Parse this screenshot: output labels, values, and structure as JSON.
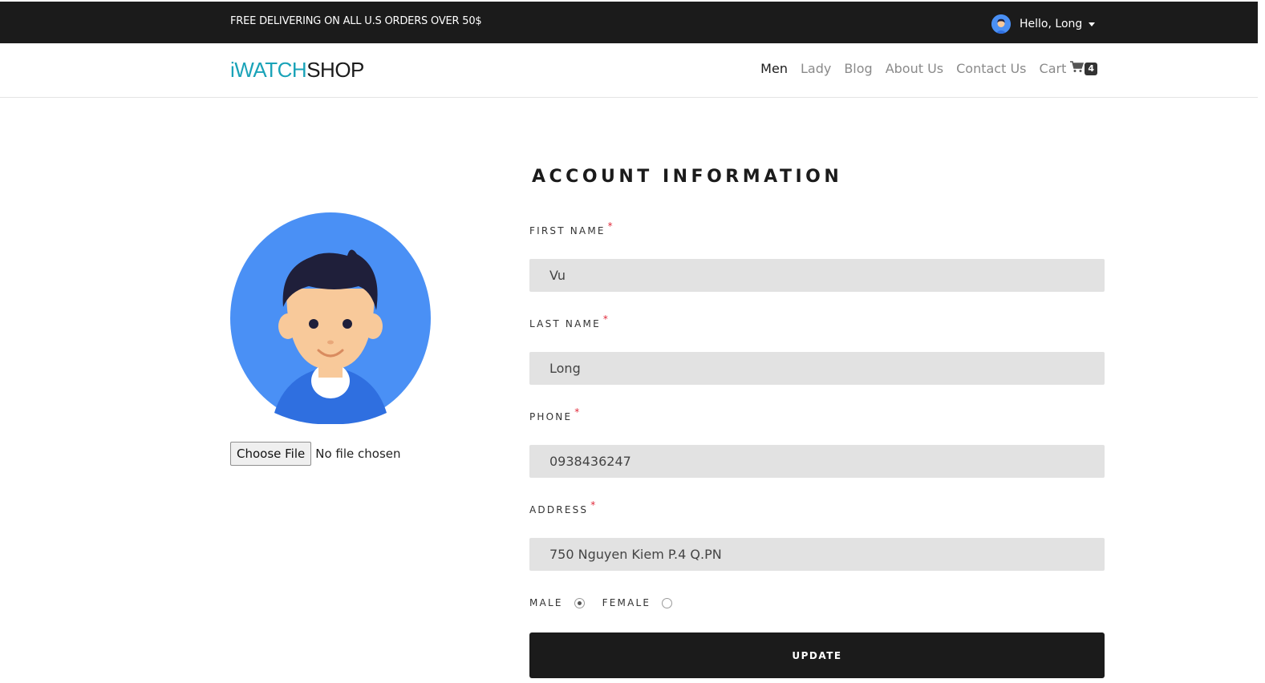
{
  "topbar": {
    "promo": "FREE DELIVERING ON ALL U.S ORDERS OVER 50$",
    "greeting": "Hello, Long"
  },
  "brand": {
    "part1": "iWATCH",
    "part2": "SHOP",
    "color_primary": "#1aa3b8",
    "color_secondary": "#1b1b1b"
  },
  "nav": {
    "items": [
      {
        "label": "Men",
        "active": true
      },
      {
        "label": "Lady"
      },
      {
        "label": "Blog"
      },
      {
        "label": "About Us"
      },
      {
        "label": "Contact Us"
      }
    ],
    "cart_label": "Cart",
    "cart_icon": "shopping-cart-icon",
    "cart_count": "4"
  },
  "profile": {
    "avatar_icon": "user-avatar-icon",
    "file_button": "Choose File",
    "file_status": "No file chosen"
  },
  "form": {
    "title": "ACCOUNT INFORMATION",
    "required_mark": "*",
    "fields": {
      "first_name": {
        "label": "FIRST NAME",
        "value": "Vu"
      },
      "last_name": {
        "label": "LAST NAME",
        "value": "Long"
      },
      "phone": {
        "label": "PHONE",
        "value": "0938436247"
      },
      "address": {
        "label": "ADDRESS",
        "value": "750 Nguyen Kiem P.4 Q.PN"
      }
    },
    "gender": {
      "male_label": "MALE",
      "female_label": "FEMALE",
      "selected": "male"
    },
    "submit_label": "UPDATE"
  }
}
